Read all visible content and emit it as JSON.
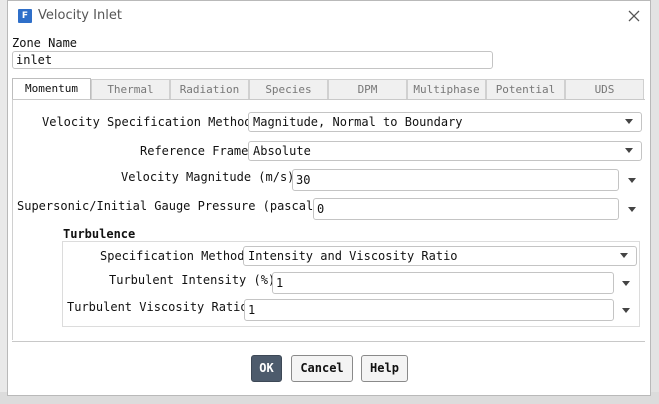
{
  "dialog": {
    "title": "Velocity Inlet"
  },
  "zone": {
    "label": "Zone Name",
    "value": "inlet"
  },
  "tabs": [
    {
      "label": "Momentum",
      "active": true
    },
    {
      "label": "Thermal"
    },
    {
      "label": "Radiation"
    },
    {
      "label": "Species"
    },
    {
      "label": "DPM"
    },
    {
      "label": "Multiphase"
    },
    {
      "label": "Potential"
    },
    {
      "label": "UDS"
    }
  ],
  "momentum": {
    "velocity_method": {
      "label": "Velocity Specification Method",
      "value": "Magnitude, Normal to Boundary"
    },
    "reference_frame": {
      "label": "Reference Frame",
      "value": "Absolute"
    },
    "velocity_magnitude": {
      "label": "Velocity Magnitude (m/s)",
      "value": "30"
    },
    "gauge_pressure": {
      "label": "Supersonic/Initial Gauge Pressure (pascal)",
      "value": "0"
    }
  },
  "turbulence": {
    "title": "Turbulence",
    "spec_method": {
      "label": "Specification Method",
      "value": "Intensity and Viscosity Ratio"
    },
    "intensity": {
      "label": "Turbulent Intensity (%)",
      "value": "1"
    },
    "viscosity_ratio": {
      "label": "Turbulent Viscosity Ratio",
      "value": "1"
    }
  },
  "buttons": {
    "ok": "OK",
    "cancel": "Cancel",
    "help": "Help"
  },
  "icons": {
    "app": "fluent-app-icon",
    "close": "close-icon",
    "dropdown": "chevron-down-icon"
  },
  "colors": {
    "ok_button": "#4d5b6c",
    "app_icon": "#2f6fc9"
  }
}
